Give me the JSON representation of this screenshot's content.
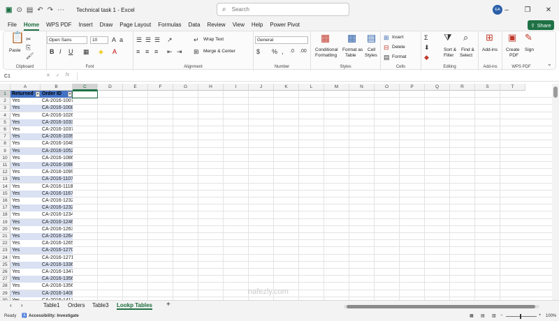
{
  "titlebar": {
    "title": "Technical task 1  -  Excel",
    "search_placeholder": "Search",
    "avatar": "EA"
  },
  "menu": {
    "tabs": [
      "File",
      "Home",
      "WPS PDF",
      "Insert",
      "Draw",
      "Page Layout",
      "Formulas",
      "Data",
      "Review",
      "View",
      "Help",
      "Power Pivot"
    ],
    "active": "Home",
    "share_label": "Share"
  },
  "ribbon": {
    "clipboard": {
      "label": "Clipboard",
      "paste": "Paste"
    },
    "font": {
      "label": "Font",
      "name": "Open Sans",
      "size": "10"
    },
    "alignment": {
      "label": "Alignment",
      "wrap": "Wrap Text",
      "merge": "Merge & Center"
    },
    "number": {
      "label": "Number",
      "format": "General"
    },
    "styles": {
      "label": "Styles",
      "conditional": "Conditional",
      "conditional2": "Formatting",
      "format_as": "Format as",
      "table": "Table",
      "cell": "Cell",
      "styles_lbl": "Styles"
    },
    "cells": {
      "label": "Cells",
      "insert": "Insert",
      "delete": "Delete",
      "format": "Format"
    },
    "editing": {
      "label": "Editing",
      "sort": "Sort &",
      "filter": "Filter",
      "find": "Find &",
      "select": "Select"
    },
    "addins": {
      "label": "Add-ins",
      "btn": "Add-ins"
    },
    "wps": {
      "label": "WPS PDF",
      "create": "Create",
      "pdf": "PDF",
      "sign": "Sign"
    }
  },
  "formula_bar": {
    "name_box": "C1",
    "fx": "fx",
    "value": ""
  },
  "columns": [
    "A",
    "B",
    "C",
    "D",
    "E",
    "F",
    "G",
    "H",
    "I",
    "J",
    "K",
    "L",
    "M",
    "N",
    "O",
    "P",
    "Q",
    "R",
    "S",
    "T"
  ],
  "headers": {
    "a": "Returned",
    "b": "Order ID"
  },
  "rows": [
    {
      "n": "2",
      "a": "Yes",
      "b": "CA-2016-100762"
    },
    {
      "n": "3",
      "a": "Yes",
      "b": "CA-2016-100867"
    },
    {
      "n": "4",
      "a": "Yes",
      "b": "CA-2016-102652"
    },
    {
      "n": "5",
      "a": "Yes",
      "b": "CA-2016-103373"
    },
    {
      "n": "6",
      "a": "Yes",
      "b": "CA-2016-103744"
    },
    {
      "n": "7",
      "a": "Yes",
      "b": "CA-2016-103940"
    },
    {
      "n": "8",
      "a": "Yes",
      "b": "CA-2016-104829"
    },
    {
      "n": "9",
      "a": "Yes",
      "b": "CA-2016-105270"
    },
    {
      "n": "10",
      "a": "Yes",
      "b": "CA-2016-108609"
    },
    {
      "n": "11",
      "a": "Yes",
      "b": "CA-2016-108861"
    },
    {
      "n": "12",
      "a": "Yes",
      "b": "CA-2016-109918"
    },
    {
      "n": "13",
      "a": "Yes",
      "b": "CA-2016-110786"
    },
    {
      "n": "14",
      "a": "Yes",
      "b": "CA-2016-111871"
    },
    {
      "n": "15",
      "a": "Yes",
      "b": "CA-2016-116785"
    },
    {
      "n": "16",
      "a": "Yes",
      "b": "CA-2016-123225"
    },
    {
      "n": "17",
      "a": "Yes",
      "b": "CA-2016-123253"
    },
    {
      "n": "18",
      "a": "Yes",
      "b": "CA-2016-123498"
    },
    {
      "n": "19",
      "a": "Yes",
      "b": "CA-2016-124688"
    },
    {
      "n": "20",
      "a": "Yes",
      "b": "CA-2016-126361"
    },
    {
      "n": "21",
      "a": "Yes",
      "b": "CA-2016-126403"
    },
    {
      "n": "22",
      "a": "Yes",
      "b": "CA-2016-126522"
    },
    {
      "n": "23",
      "a": "Yes",
      "b": "CA-2016-127012"
    },
    {
      "n": "24",
      "a": "Yes",
      "b": "CA-2016-127131"
    },
    {
      "n": "25",
      "a": "Yes",
      "b": "CA-2016-133690"
    },
    {
      "n": "26",
      "a": "Yes",
      "b": "CA-2016-134726"
    },
    {
      "n": "27",
      "a": "Yes",
      "b": "CA-2016-135657"
    },
    {
      "n": "28",
      "a": "Yes",
      "b": "CA-2016-135699"
    },
    {
      "n": "29",
      "a": "Yes",
      "b": "CA-2016-140816"
    },
    {
      "n": "30",
      "a": "Yes",
      "b": "CA-2016-141726"
    },
    {
      "n": "31",
      "a": "Yes",
      "b": "CA-2016-142769"
    },
    {
      "n": "32",
      "a": "Yes",
      "b": "CA-2016-143336"
    }
  ],
  "sheets": [
    "Table1",
    "Orders",
    "Table3",
    "Lookp Tables"
  ],
  "active_sheet": "Lookp Tables",
  "status": {
    "ready": "Ready",
    "accessibility": "Accessibility: Investigate",
    "zoom": "100%"
  },
  "watermark": "nafezly.com",
  "colors": {
    "accent": "#1e7145",
    "table_header": "#4472c4",
    "band": "#d9e1f2"
  }
}
